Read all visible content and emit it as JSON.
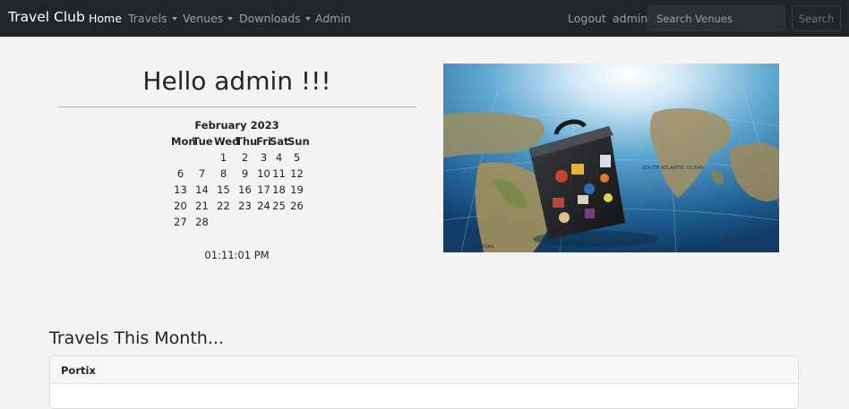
{
  "navbar": {
    "brand": "Travel Club",
    "items": [
      {
        "label": "Home"
      },
      {
        "label": "Travels"
      },
      {
        "label": "Venues"
      },
      {
        "label": "Downloads"
      },
      {
        "label": "Admin"
      }
    ],
    "logout": "Logout",
    "user": "admin",
    "search_placeholder": "Search Venues",
    "search_button": "Search",
    "colors": {
      "background": "#212529",
      "active": "#ffffff",
      "muted": "#8c8f92"
    }
  },
  "greeting": "Hello admin !!!",
  "calendar": {
    "month": "February 2023",
    "weekdays": [
      "Mon",
      "Tue",
      "Wed",
      "Thu",
      "Fri",
      "Sat",
      "Sun"
    ],
    "weeks": [
      [
        "",
        "",
        "1",
        "2",
        "3",
        "4",
        "5"
      ],
      [
        "6",
        "7",
        "8",
        "9",
        "10",
        "11",
        "12"
      ],
      [
        "13",
        "14",
        "15",
        "16",
        "17",
        "18",
        "19"
      ],
      [
        "20",
        "21",
        "22",
        "23",
        "24",
        "25",
        "26"
      ],
      [
        "27",
        "28",
        "",
        "",
        "",
        "",
        ""
      ]
    ]
  },
  "clock": "01:11:01 PM",
  "hero_image": {
    "map_labels": [
      "SOUTH ATLANTIC OCEAN",
      "ARGENTINA"
    ]
  },
  "travels_section": {
    "title": "Travels This Month...",
    "cards": [
      {
        "name": "Portix"
      }
    ]
  }
}
